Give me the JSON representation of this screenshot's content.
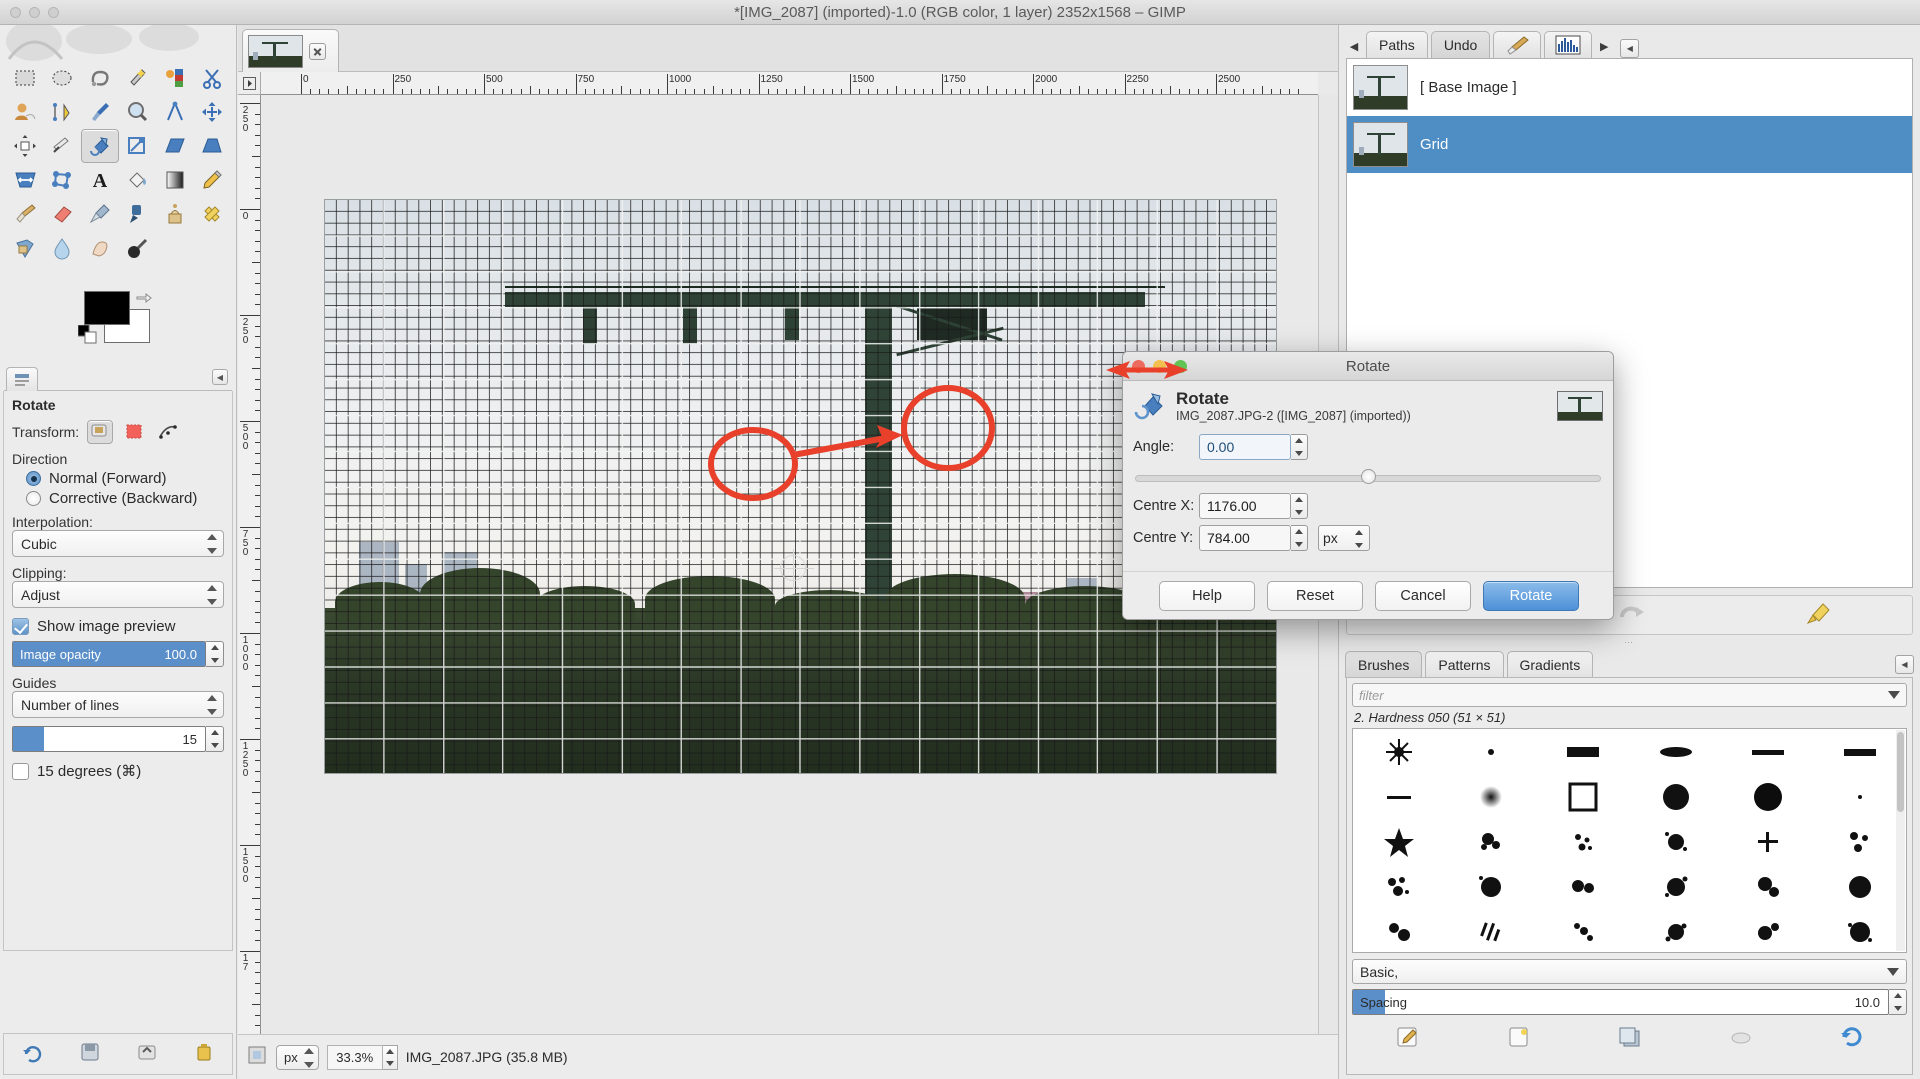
{
  "window": {
    "title": "*[IMG_2087] (imported)-1.0 (RGB color, 1 layer) 2352x1568 – GIMP"
  },
  "toolbox": {
    "tools": [
      {
        "name": "rect-select-tool",
        "label": "Rectangle Select"
      },
      {
        "name": "ellipse-select-tool",
        "label": "Ellipse Select"
      },
      {
        "name": "free-select-tool",
        "label": "Free Select"
      },
      {
        "name": "fuzzy-select-tool",
        "label": "Fuzzy Select"
      },
      {
        "name": "select-by-color-tool",
        "label": "Select by Color"
      },
      {
        "name": "scissors-select-tool",
        "label": "Scissors Select"
      },
      {
        "name": "foreground-select-tool",
        "label": "Foreground Select"
      },
      {
        "name": "paths-tool",
        "label": "Paths"
      },
      {
        "name": "color-picker-tool",
        "label": "Color Picker"
      },
      {
        "name": "zoom-tool",
        "label": "Zoom"
      },
      {
        "name": "measure-tool",
        "label": "Measure"
      },
      {
        "name": "move-tool",
        "label": "Move"
      },
      {
        "name": "align-tool",
        "label": "Alignment"
      },
      {
        "name": "crop-tool",
        "label": "Crop"
      },
      {
        "name": "rotate-tool",
        "label": "Rotate"
      },
      {
        "name": "scale-tool",
        "label": "Scale"
      },
      {
        "name": "shear-tool",
        "label": "Shear"
      },
      {
        "name": "perspective-tool",
        "label": "Perspective"
      },
      {
        "name": "flip-tool",
        "label": "Flip"
      },
      {
        "name": "cage-transform-tool",
        "label": "Cage Transform"
      },
      {
        "name": "text-tool",
        "label": "Text"
      },
      {
        "name": "bucket-fill-tool",
        "label": "Bucket Fill"
      },
      {
        "name": "blend-gradient-tool",
        "label": "Blend"
      },
      {
        "name": "pencil-tool",
        "label": "Pencil"
      },
      {
        "name": "paintbrush-tool",
        "label": "Paintbrush"
      },
      {
        "name": "eraser-tool",
        "label": "Eraser"
      },
      {
        "name": "airbrush-tool",
        "label": "Airbrush"
      },
      {
        "name": "ink-tool",
        "label": "Ink"
      },
      {
        "name": "clone-tool",
        "label": "Clone"
      },
      {
        "name": "heal-tool",
        "label": "Heal"
      },
      {
        "name": "perspective-clone-tool",
        "label": "Perspective Clone"
      },
      {
        "name": "blur-sharpen-tool",
        "label": "Blur / Sharpen"
      },
      {
        "name": "smudge-tool",
        "label": "Smudge"
      },
      {
        "name": "dodge-burn-tool",
        "label": "Dodge / Burn"
      }
    ],
    "active_tool_index": 14,
    "foreground_color": "#000000",
    "background_color": "#ffffff"
  },
  "tool_options": {
    "title": "Rotate",
    "transform_label": "Transform:",
    "transform_targets": [
      "layer-transform-icon",
      "selection-transform-icon",
      "path-transform-icon"
    ],
    "active_transform_index": 0,
    "direction_label": "Direction",
    "direction_options": [
      {
        "label": "Normal (Forward)",
        "selected": true
      },
      {
        "label": "Corrective (Backward)",
        "selected": false
      }
    ],
    "interpolation_label": "Interpolation:",
    "interpolation_value": "Cubic",
    "clipping_label": "Clipping:",
    "clipping_value": "Adjust",
    "show_preview_label": "Show image preview",
    "show_preview_checked": true,
    "opacity_label": "Image opacity",
    "opacity_value": "100.0",
    "opacity_percent": 100,
    "guides_label": "Guides",
    "guides_value": "Number of lines",
    "lines_value": "15",
    "lines_percent": 16,
    "constrain_label": "15 degrees  (⌘)",
    "constrain_checked": false,
    "footer_icons": [
      "reset-tool-icon",
      "save-options-icon",
      "restore-options-icon",
      "delete-options-icon"
    ]
  },
  "canvas": {
    "tab_title": "IMG_2087.JPG",
    "tab_close_icon": "close-icon",
    "h_ruler_ticks": [
      "0",
      "250",
      "500",
      "750",
      "1000",
      "1250",
      "1500",
      "1750",
      "2000",
      "2250",
      "2500"
    ],
    "v_ruler_ticks": [
      "250",
      "0",
      "250",
      "500",
      "750",
      "1000",
      "1250",
      "1500",
      "17"
    ],
    "quickmask_icon": "quick-mask-icon",
    "navigation_icon": "navigation-icon",
    "zoom_corner_icon": "zoom-image-icon"
  },
  "status_bar": {
    "unit": "px",
    "zoom": "33.3%",
    "message": "IMG_2087.JPG (35.8 MB)"
  },
  "right_dock": {
    "tabs": [
      {
        "label": "Paths",
        "type": "text",
        "selected": false
      },
      {
        "label": "Undo",
        "type": "text",
        "selected": true
      },
      {
        "label": "",
        "type": "icon",
        "icon": "paintbrush-icon",
        "selected": false
      },
      {
        "label": "",
        "type": "icon",
        "icon": "histogram-icon",
        "selected": false
      }
    ],
    "prev_icon": "chevron-left-icon",
    "next_icon": "chevron-right-icon",
    "collapse_icon": "collapse-icon",
    "undo_history": [
      {
        "label": "[ Base Image ]",
        "selected": false
      },
      {
        "label": "Grid",
        "selected": true
      }
    ],
    "undo_buttons": [
      "undo-icon",
      "redo-icon",
      "clear-history-icon"
    ],
    "brush_tabs": [
      {
        "label": "Brushes",
        "selected": true
      },
      {
        "label": "Patterns",
        "selected": false
      },
      {
        "label": "Gradients",
        "selected": false
      }
    ],
    "brush_collapse_icon": "collapse-icon",
    "filter_placeholder": "filter",
    "filter_value": "",
    "selected_brush": "2. Hardness 050 (51 × 51)",
    "basic_value": "Basic,",
    "spacing_label": "Spacing",
    "spacing_value": "10.0",
    "spacing_percent": 10,
    "brush_footer_icons": [
      "edit-brush-icon",
      "new-brush-icon",
      "duplicate-brush-icon",
      "delete-brush-icon",
      "refresh-brushes-icon"
    ]
  },
  "rotate_dialog": {
    "window_title": "Rotate",
    "heading": "Rotate",
    "subheading": "IMG_2087.JPG-2 ([IMG_2087] (imported))",
    "icon": "rotate-icon",
    "preview_icon": "image-preview-thumbnail",
    "fields": [
      {
        "name": "angle",
        "label": "Angle:",
        "value": "0.00",
        "focused": true
      },
      {
        "name": "centre-x",
        "label": "Centre X:",
        "value": "1176.00",
        "focused": false
      },
      {
        "name": "centre-y",
        "label": "Centre Y:",
        "value": "784.00",
        "focused": false
      }
    ],
    "unit": "px",
    "angle_slider_percent": 50,
    "buttons": [
      {
        "label": "Help",
        "primary": false
      },
      {
        "label": "Reset",
        "primary": false
      },
      {
        "label": "Cancel",
        "primary": false
      },
      {
        "label": "Rotate",
        "primary": true
      }
    ],
    "traffic_lights": [
      "#ec6a5e",
      "#f5bf4f",
      "#61c454"
    ]
  },
  "annotations": {
    "color": "#e8402a",
    "items": [
      {
        "name": "pivot-highlight-ellipse",
        "shape": "ellipse"
      },
      {
        "name": "centre-fields-highlight-ellipse",
        "shape": "ellipse"
      },
      {
        "name": "pivot-to-fields-arrow",
        "shape": "arrow"
      },
      {
        "name": "angle-double-arrow",
        "shape": "double-arrow"
      }
    ]
  }
}
